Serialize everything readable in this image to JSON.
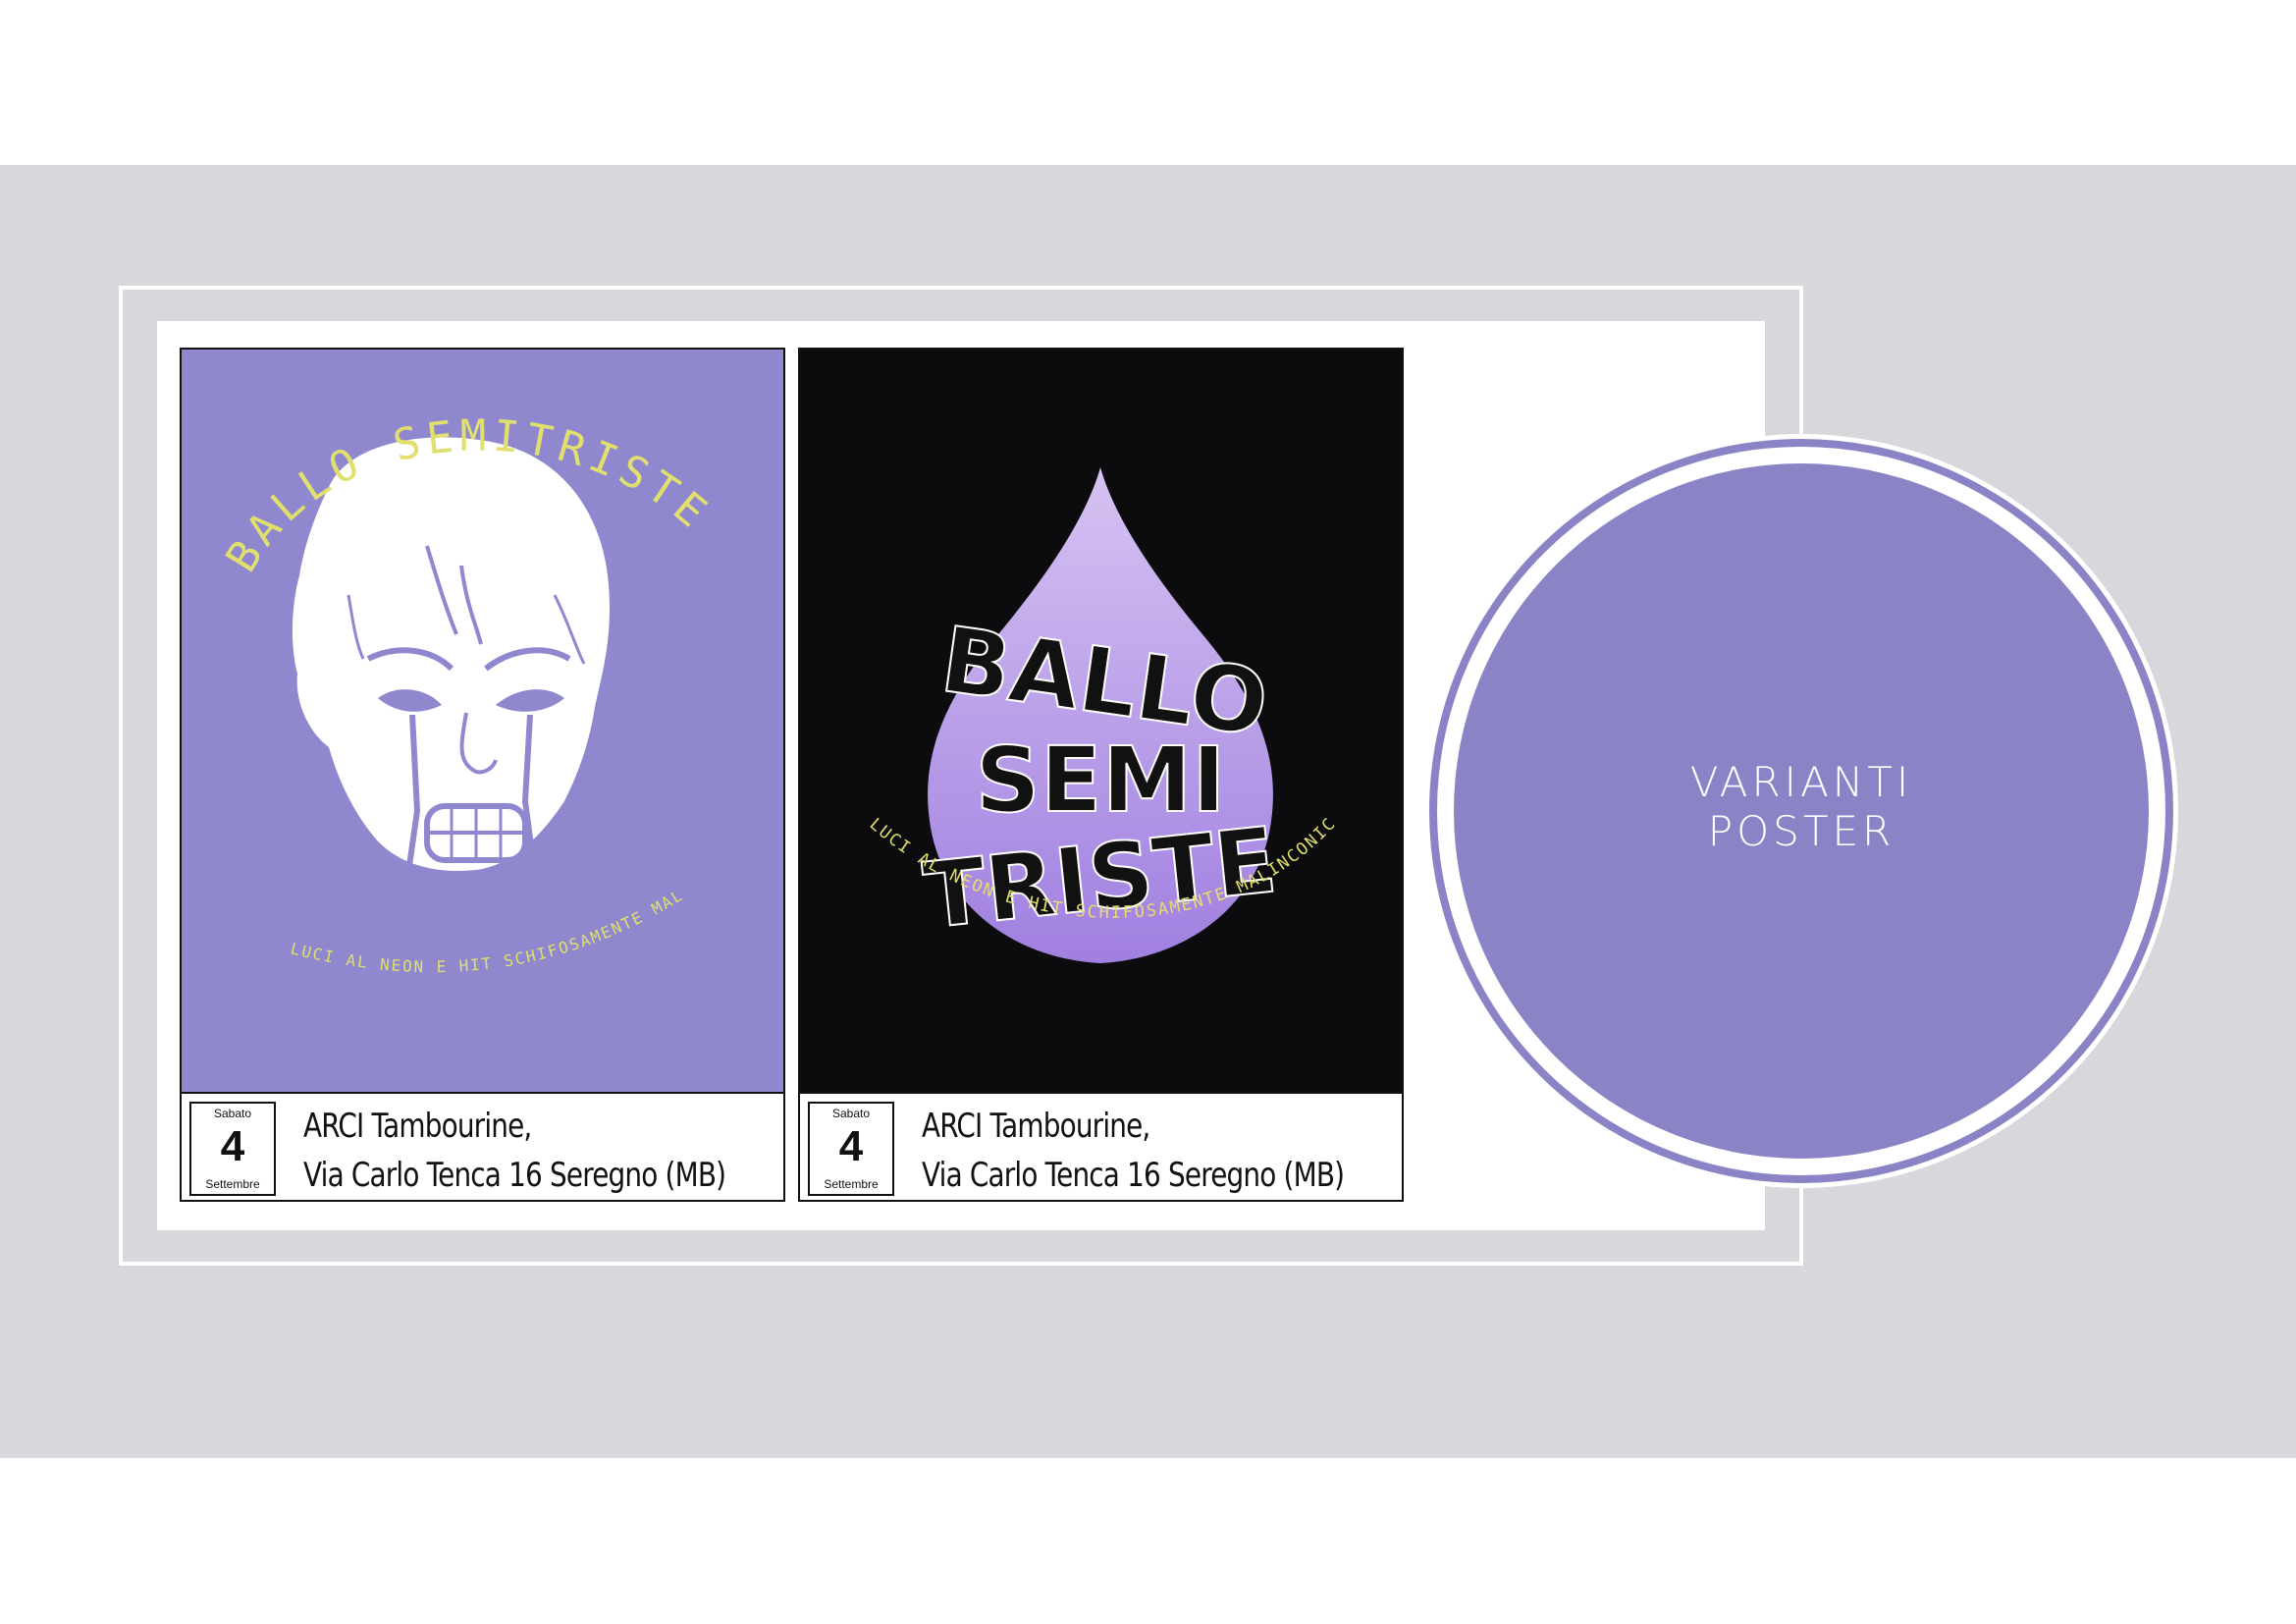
{
  "slide": {
    "title_line1": "VARIANTI",
    "title_line2": "POSTER",
    "accent_color": "#8a84c6",
    "band_color": "#d9d7db"
  },
  "posters": [
    {
      "style": "purple-face",
      "headline": "BALLO SEMITRISTE",
      "tagline": "LUCI AL NEON E HIT SCHIFOSAMENTE MALINCONICHE",
      "date_day_name": "Sabato",
      "date_day_num": "4",
      "date_month": "Settembre",
      "venue_line1": "ARCI Tambourine,",
      "venue_line2": "Via Carlo Tenca 16 Seregno (MB)"
    },
    {
      "style": "black-drop",
      "headline_line1": "BALLO",
      "headline_line2": "SEMI",
      "headline_line3": "TRISTE",
      "tagline": "LUCI AL NEON E HIT SCHIFOSAMENTE MALINCONICHE",
      "date_day_name": "Sabato",
      "date_day_num": "4",
      "date_month": "Settembre",
      "venue_line1": "ARCI Tambourine,",
      "venue_line2": "Via Carlo Tenca 16 Seregno (MB)"
    }
  ]
}
